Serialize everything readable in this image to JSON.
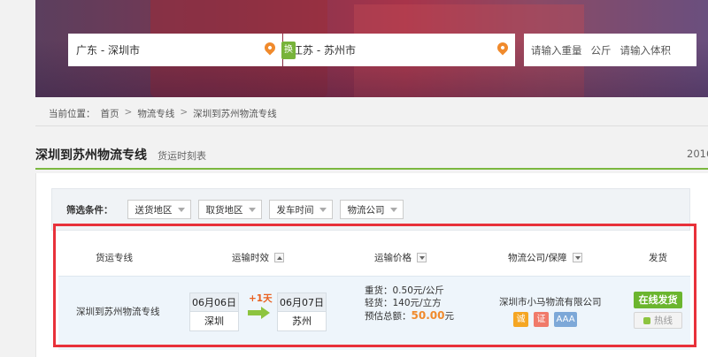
{
  "search": {
    "from": "广东 - 深圳市",
    "swap_label": "换",
    "to": "江苏 - 苏州市",
    "weight_placeholder": "请输入重量",
    "weight_unit": "公斤",
    "volume_placeholder": "请输入体积"
  },
  "breadcrumb": {
    "label": "当前位置：",
    "items": [
      "首页",
      "物流专线",
      "深圳到苏州物流专线"
    ],
    "sep": ">"
  },
  "page": {
    "title": "深圳到苏州物流专线",
    "subtitle": "货运时刻表",
    "year_fragment": "2016"
  },
  "filters": {
    "label": "筛选条件：",
    "options": [
      "送货地区",
      "取货地区",
      "发车时间",
      "物流公司"
    ]
  },
  "table": {
    "headers": {
      "route": "货运专线",
      "time": "运输时效",
      "price": "运输价格",
      "company": "物流公司/保障",
      "send": "发货"
    },
    "rows": [
      {
        "route": "深圳到苏州物流专线",
        "depart_date": "06月06日",
        "depart_city": "深圳",
        "transit": "+1天",
        "arrive_date": "06月07日",
        "arrive_city": "苏州",
        "heavy": "重货：0.50元/公斤",
        "light": "轻货：140元/立方",
        "total_label": "预估总额：",
        "total_value": "50.00",
        "total_unit": "元",
        "company": "深圳市小马物流有限公司",
        "badges": [
          "诚",
          "证",
          "AAA"
        ],
        "send_label": "在线发货",
        "hotline_label": "热线"
      }
    ]
  },
  "colors": {
    "accent_green": "#7bb83f",
    "pin_orange": "#f08a2c",
    "highlight_red": "#e8313a"
  }
}
